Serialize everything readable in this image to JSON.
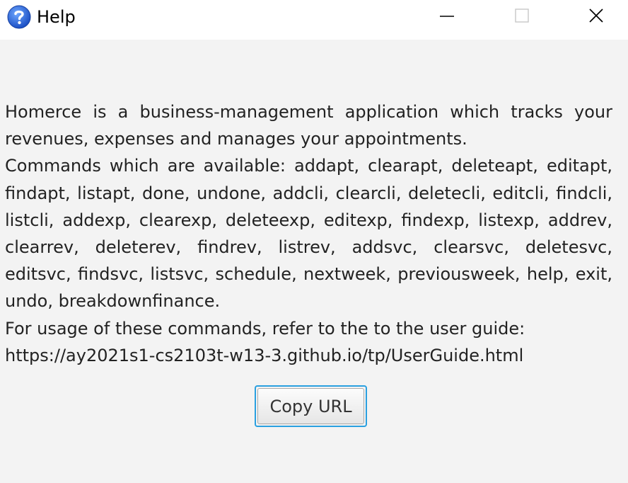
{
  "window": {
    "title": "Help",
    "app_icon": "help-question-icon",
    "controls": {
      "minimize_icon": "minimize-icon",
      "maximize_icon": "maximize-icon",
      "close_icon": "close-icon"
    }
  },
  "help": {
    "intro": "Homerce is a business-management application which tracks your revenues, expenses and manages your appointments.",
    "commands": "Commands which are available: addapt, clearapt, deleteapt, editapt, findapt, listapt, done, undone, addcli, clearcli, deletecli, editcli, findcli, listcli, addexp, clearexp, deleteexp, editexp, findexp, listexp, addrev, clearrev, deleterev, findrev, listrev, addsvc, clearsvc, deletesvc, editsvc, findsvc, listsvc, schedule, nextweek, previousweek, help, exit, undo, breakdownfinance.",
    "usage": "For usage of these commands, refer to the to the user guide:",
    "url": "https://ay2021s1-cs2103t-w13-3.github.io/tp/UserGuide.html"
  },
  "copy_button": {
    "label": "Copy URL"
  },
  "colors": {
    "titlebar_bg": "#ffffff",
    "window_bg": "#f3f3f3",
    "icon_blue": "#1f5fd6",
    "focus_border": "#2aa0e0"
  }
}
